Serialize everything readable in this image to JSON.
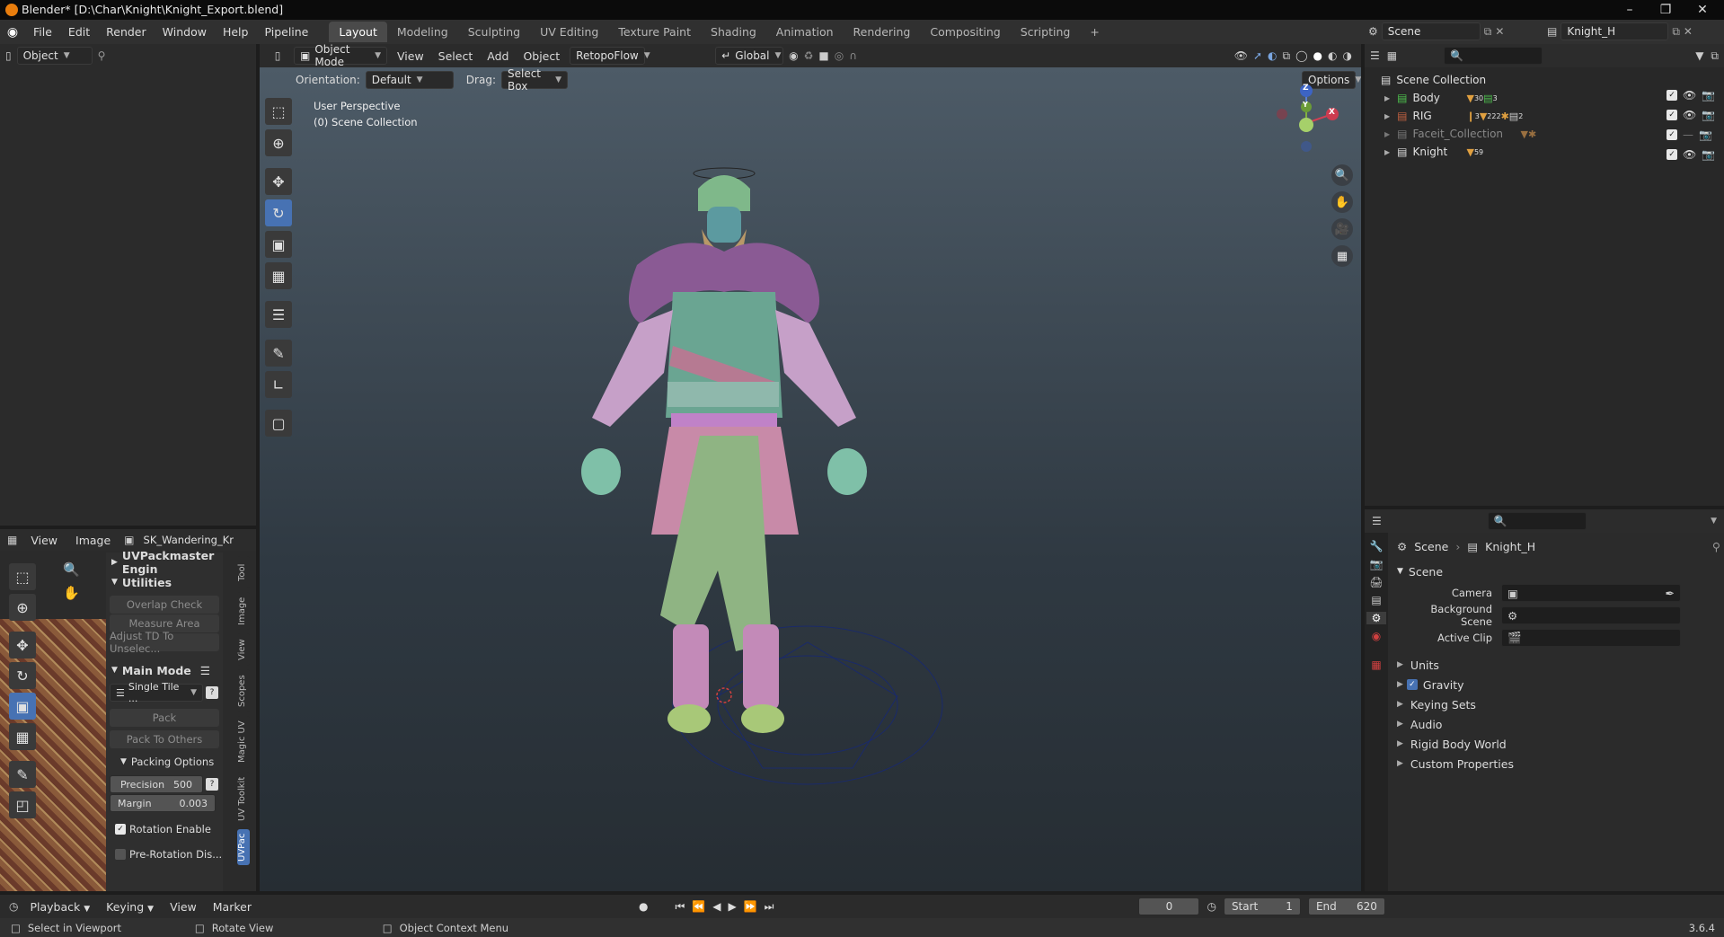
{
  "window": {
    "title": "Blender* [D:\\Char\\Knight\\Knight_Export.blend]",
    "min_icon": "minimize-icon",
    "max_icon": "restore-icon",
    "close_icon": "close-icon"
  },
  "menus": [
    "File",
    "Edit",
    "Render",
    "Window",
    "Help",
    "Pipeline"
  ],
  "workspaces": [
    {
      "label": "Layout",
      "active": true
    },
    {
      "label": "Modeling"
    },
    {
      "label": "Sculpting"
    },
    {
      "label": "UV Editing"
    },
    {
      "label": "Texture Paint"
    },
    {
      "label": "Shading"
    },
    {
      "label": "Animation"
    },
    {
      "label": "Rendering"
    },
    {
      "label": "Compositing"
    },
    {
      "label": "Scripting"
    }
  ],
  "scene_selector": {
    "label": "Scene"
  },
  "viewlayer_selector": {
    "label": "Knight_H"
  },
  "left_top": {
    "mode_label": "Object"
  },
  "viewport": {
    "mode": "Object Mode",
    "menu": [
      "View",
      "Select",
      "Add",
      "Object",
      "RetopoFlow"
    ],
    "transform_orientation": "Global",
    "orientation_label": "Orientation:",
    "orientation_value": "Default",
    "drag_label": "Drag:",
    "drag_value": "Select Box",
    "options_label": "Options",
    "overlay_line1": "User Perspective",
    "overlay_line2": "(0) Scene Collection",
    "gizmo": {
      "z": "Z",
      "x": "X",
      "y": "Y"
    }
  },
  "outliner": {
    "root": "Scene Collection",
    "items": [
      {
        "label": "Body",
        "badge1": "30",
        "badge2": "3",
        "dim": false
      },
      {
        "label": "RIG",
        "badge1": "3",
        "badge2": "222",
        "badge3": "2",
        "dim": false
      },
      {
        "label": "Faceit_Collection",
        "dim": true
      },
      {
        "label": "Knight",
        "badge1": "59",
        "dim": false
      }
    ]
  },
  "properties": {
    "breadcrumb1": "Scene",
    "breadcrumb2": "Knight_H",
    "section": "Scene",
    "fields": [
      {
        "label": "Camera"
      },
      {
        "label": "Background Scene"
      },
      {
        "label": "Active Clip"
      }
    ],
    "subpanels": [
      {
        "label": "Units",
        "checkbox": false
      },
      {
        "label": "Gravity",
        "checkbox": true
      },
      {
        "label": "Keying Sets",
        "checkbox": false
      },
      {
        "label": "Audio",
        "checkbox": false
      },
      {
        "label": "Rigid Body World",
        "checkbox": false
      },
      {
        "label": "Custom Properties",
        "checkbox": false
      }
    ]
  },
  "uv_editor": {
    "menu": [
      "View",
      "Image"
    ],
    "image_name": "SK_Wandering_Knig",
    "engine_label": "UVPackmaster Engin",
    "utilities": "Utilities",
    "util_buttons": [
      "Overlap Check",
      "Measure Area",
      "Adjust TD To Unselec..."
    ],
    "main_mode": "Main Mode",
    "tile_mode": "Single Tile ...",
    "pack": "Pack",
    "pack_others": "Pack To Others",
    "packing_options": "Packing Options",
    "precision_label": "Precision",
    "precision_value": "500",
    "margin_label": "Margin",
    "margin_value": "0.003",
    "rotation_enable": "Rotation Enable",
    "pre_rotation": "Pre-Rotation Dis...",
    "side_tabs": [
      "Tool",
      "Image",
      "View",
      "Scopes",
      "Magic UV",
      "UV Toolkit",
      "UVPac"
    ]
  },
  "timeline": {
    "menu": [
      "Playback",
      "Keying",
      "View",
      "Marker"
    ],
    "current_frame": "0",
    "start_label": "Start",
    "start": "1",
    "end_label": "End",
    "end": "620"
  },
  "statusbar": {
    "hint1": "Select in Viewport",
    "hint2": "Rotate View",
    "hint3": "Object Context Menu",
    "version": "3.6.4"
  }
}
